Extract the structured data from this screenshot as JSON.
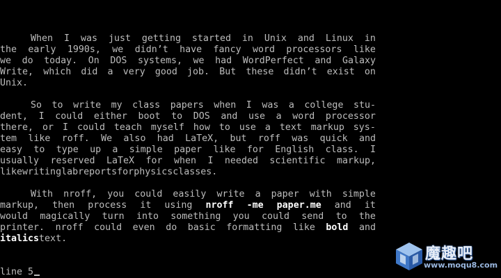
{
  "document": {
    "paragraphs": [
      {
        "lines": [
          [
            "When",
            "I",
            "was",
            "just",
            "getting",
            "started",
            "in",
            "Unix",
            "and",
            "Linux",
            "in"
          ],
          [
            "the",
            "early",
            "1990s,",
            "we",
            "didn’t",
            "have",
            "fancy",
            "word",
            "processors",
            "like"
          ],
          [
            "we",
            "do",
            "today.",
            "On",
            "DOS",
            "systems,",
            "we",
            "had",
            "WordPerfect",
            "and",
            "Galaxy"
          ],
          [
            "Write,",
            "which",
            "did",
            "a",
            "very",
            "good",
            "job.",
            "But",
            "these",
            "didn’t",
            "exist",
            "on"
          ],
          [
            "Unix."
          ]
        ]
      },
      {
        "lines": [
          [
            "So",
            "to",
            "write",
            "my",
            "class",
            "papers",
            "when",
            "I",
            "was",
            "a",
            "college",
            "stu-"
          ],
          [
            "dent,",
            "I",
            "could",
            "either",
            "boot",
            "to",
            "DOS",
            "and",
            "use",
            "a",
            "word",
            "processor"
          ],
          [
            "there,",
            "or",
            "I",
            "could",
            "teach",
            "myself",
            "how",
            "to",
            "use",
            "a",
            "text",
            "markup",
            "sys-"
          ],
          [
            "tem",
            "like",
            "roff.",
            "We",
            "also",
            "had",
            "LaTeX,",
            "but",
            "roff",
            "was",
            "quick",
            "and"
          ],
          [
            "easy",
            "to",
            "type",
            "up",
            "a",
            "simple",
            "paper",
            "like",
            "for",
            "English",
            "class.",
            "I"
          ],
          [
            "usually",
            "reserved",
            "LaTeX",
            "for",
            "when",
            "I",
            "needed",
            "scientific",
            "markup,"
          ],
          [
            "like",
            "writing",
            "lab",
            "reports",
            "for",
            "physics",
            "classes."
          ]
        ]
      },
      {
        "lines": [
          [
            "With",
            "nroff,",
            "you",
            "could",
            "easily",
            "write",
            "a",
            "paper",
            "with",
            "simple"
          ],
          [
            "markup,",
            "then",
            "process",
            "it",
            "using",
            "*nroff",
            "*-me",
            "*paper.me",
            "and",
            "it"
          ],
          [
            "would",
            "magically",
            "turn",
            "into",
            "something",
            "you",
            "could",
            "send",
            "to",
            "the"
          ],
          [
            "printer.",
            "nroff",
            "could",
            "even",
            "do",
            "basic",
            "formatting",
            "like",
            "*bold",
            "and"
          ],
          [
            "*italics",
            "text."
          ]
        ]
      }
    ]
  },
  "status": {
    "text": "line 5"
  },
  "watermark": {
    "cn": "魔趣吧",
    "url": "www.moqu8.com"
  },
  "colors": {
    "text": "#bdbdbd",
    "bold": "#ffffff",
    "background": "#000000"
  }
}
